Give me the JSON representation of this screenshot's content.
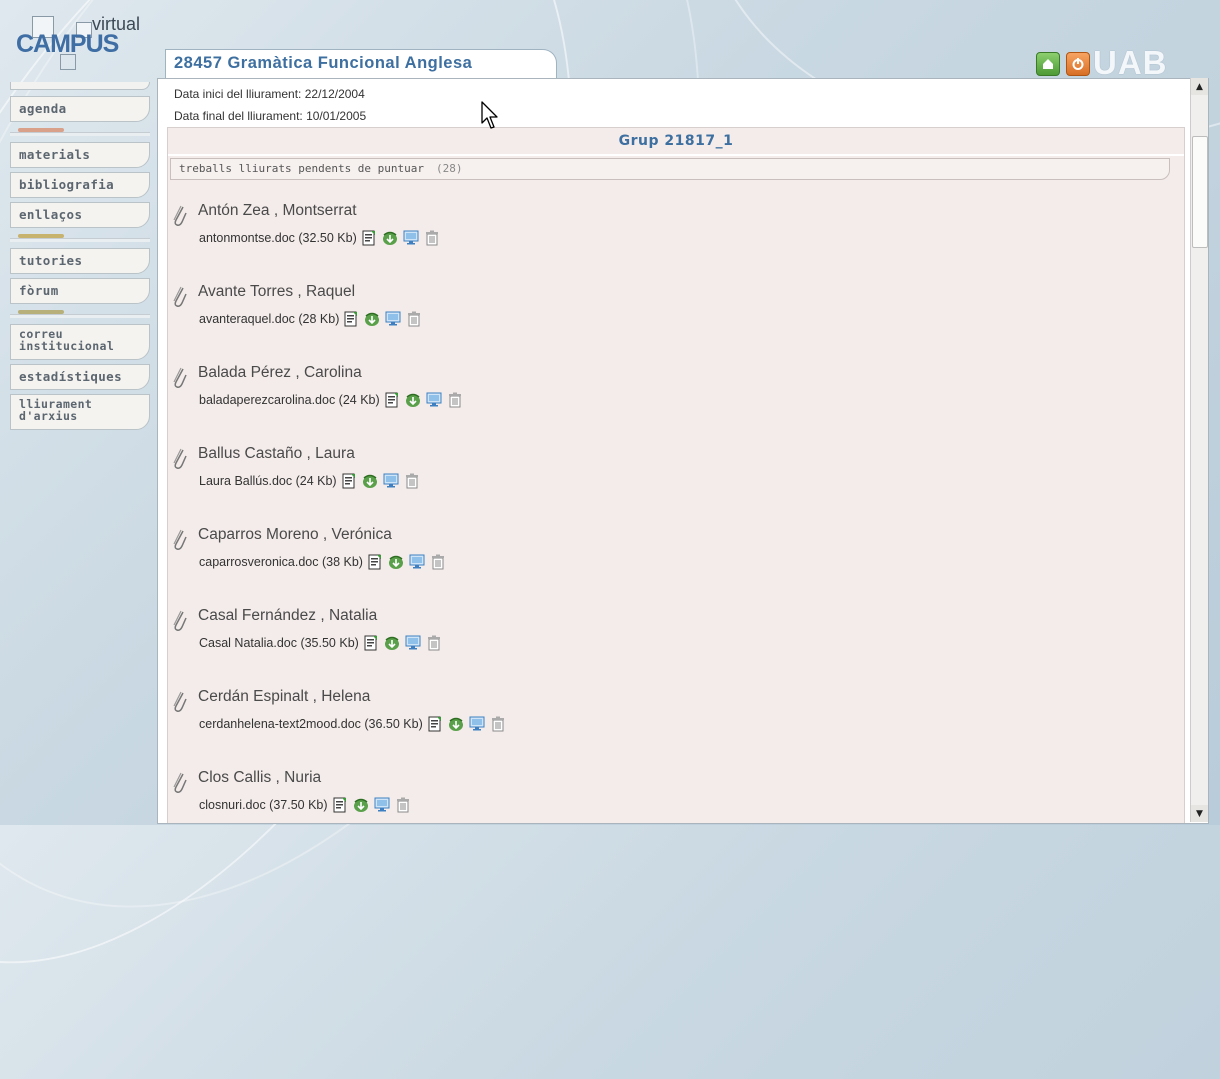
{
  "logo": {
    "top_text": "virtual",
    "main_text": "CAMPUS"
  },
  "header": {
    "course_tab": "28457 Gramàtica Funcional Anglesa",
    "uab_logo": "UAB"
  },
  "sidebar": {
    "items": [
      {
        "label": "agenda"
      },
      {
        "label": "materials"
      },
      {
        "label": "bibliografia"
      },
      {
        "label": "enllaços"
      },
      {
        "label": "tutories"
      },
      {
        "label": "fòrum"
      },
      {
        "label": "correu institucional"
      },
      {
        "label": "estadístiques"
      },
      {
        "label": "lliurament d'arxius"
      }
    ],
    "separator_colors": [
      "#d9a08a",
      "#c8b36e",
      "#b7b07a"
    ]
  },
  "info": {
    "start": "Data inici del lliurament: 22/12/2004",
    "end": "Data final del lliurament: 10/01/2005"
  },
  "group": {
    "title": "Grup 21817_1"
  },
  "pending": {
    "label": "treballs lliurats pendents de puntuar",
    "count": "(28)"
  },
  "entries": [
    {
      "name": "Antón Zea , Montserrat",
      "file": "antonmontse.doc (32.50 Kb)"
    },
    {
      "name": "Avante Torres , Raquel",
      "file": "avanteraquel.doc (28 Kb)"
    },
    {
      "name": "Balada Pérez , Carolina",
      "file": "baladaperezcarolina.doc (24 Kb)"
    },
    {
      "name": "Ballus Castaño , Laura",
      "file": "Laura Ballús.doc (24 Kb)"
    },
    {
      "name": "Caparros Moreno , Verónica",
      "file": "caparrosveronica.doc (38 Kb)"
    },
    {
      "name": "Casal Fernández , Natalia",
      "file": "Casal Natalia.doc (35.50 Kb)"
    },
    {
      "name": "Cerdán Espinalt , Helena",
      "file": "cerdanhelena-text2mood.doc (36.50 Kb)"
    },
    {
      "name": "Clos Callis , Nuria",
      "file": "closnuri.doc (37.50 Kb)"
    }
  ],
  "icons": {
    "home": "home-icon",
    "power": "power-icon",
    "clip": "paperclip-icon",
    "grade": "grade-document-icon",
    "download": "download-icon",
    "view": "view-screen-icon",
    "delete": "trash-icon"
  },
  "colors": {
    "accent": "#3d6fa0",
    "content_bg": "#f3ecea"
  }
}
